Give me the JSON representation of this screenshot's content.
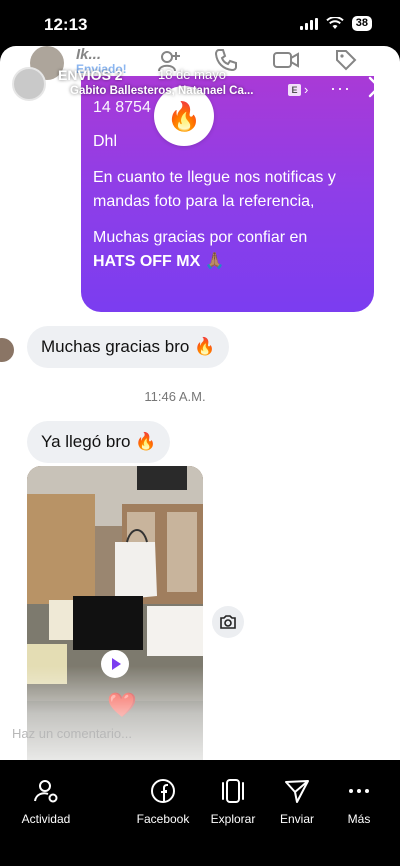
{
  "status_bar": {
    "time": "12:13",
    "battery": "38"
  },
  "chat_header": {
    "name": "Ik...",
    "subtitle": "Enviado!"
  },
  "story_overlay": {
    "title": "ENVIOS 2",
    "date": "18 de mayo",
    "music": "Gabito Ballesteros, Natanael Ca...",
    "explicit_badge": "E"
  },
  "messages": {
    "shipment": {
      "tracking": "14 8754",
      "carrier": "Dhl",
      "paragraph1": "En cuanto te llegue nos notificas y mandas foto para la referencia,",
      "paragraph2_prefix": "Muchas gracias por confiar en",
      "brand": "HATS OFF MX",
      "brand_emoji": "🙏🏽",
      "reaction": "🔥"
    },
    "reply1": "Muchas gracias bro 🔥",
    "timestamp": "11:46 A.M.",
    "reply2": "Ya llegó bro 🔥",
    "video_reaction": "❤️"
  },
  "comment": {
    "placeholder": "Haz un comentario..."
  },
  "actions": [
    {
      "label": "Actividad",
      "icon": "activity-icon"
    },
    {
      "label": "Facebook",
      "icon": "facebook-icon"
    },
    {
      "label": "Explorar",
      "icon": "explore-icon"
    },
    {
      "label": "Enviar",
      "icon": "send-icon"
    },
    {
      "label": "Más",
      "icon": "more-icon"
    }
  ]
}
